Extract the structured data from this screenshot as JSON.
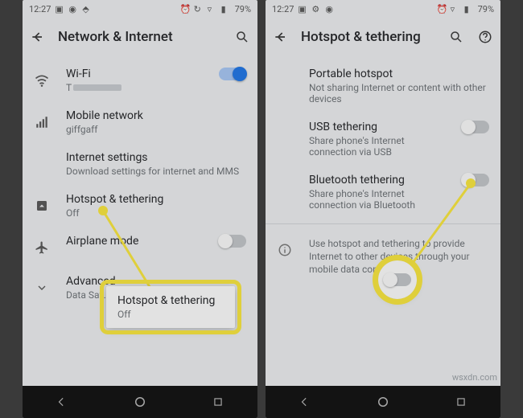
{
  "statusbar": {
    "time": "12:27",
    "battery": "79%"
  },
  "left": {
    "title": "Network & Internet",
    "items": [
      {
        "label": "Wi-Fi",
        "sub": "T"
      },
      {
        "label": "Mobile network",
        "sub": "giffgaff"
      },
      {
        "label": "Internet settings",
        "sub": "Download settings for internet and MMS"
      },
      {
        "label": "Hotspot & tethering",
        "sub": "Off"
      },
      {
        "label": "Airplane mode",
        "sub": ""
      },
      {
        "label": "Advanced",
        "sub": "Data Sav…, VPN, …"
      }
    ],
    "callout": {
      "label": "Hotspot & tethering",
      "sub": "Off"
    }
  },
  "right": {
    "title": "Hotspot & tethering",
    "items": [
      {
        "label": "Portable hotspot",
        "sub": "Not sharing Internet or content with other devices"
      },
      {
        "label": "USB tethering",
        "sub": "Share phone's Internet connection via USB"
      },
      {
        "label": "Bluetooth tethering",
        "sub": "Share phone's Internet connection via Bluetooth"
      }
    ],
    "info": "Use hotspot and tethering to provide Internet to other devices through your mobile data connection."
  },
  "watermark": "wsxdn.com"
}
